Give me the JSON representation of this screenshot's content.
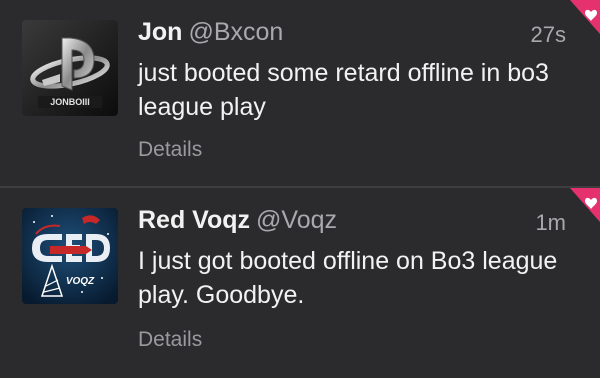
{
  "tweets": [
    {
      "name": "Jon",
      "handle": "@Bxcon",
      "time": "27s",
      "text": "just booted some retard offline in bo3 league play",
      "details_label": "Details",
      "avatar_caption": "JONBOIII",
      "favorite_color": "#e5316e"
    },
    {
      "name": "Red Voqz",
      "handle": "@Voqz",
      "time": "1m",
      "text": "I just got booted offline on Bo3 league play. Goodbye.",
      "details_label": "Details",
      "avatar_caption": "VOQZ",
      "favorite_color": "#e5316e"
    }
  ],
  "colors": {
    "background": "#2b2b2d",
    "separator": "#3d3d40",
    "primary_text": "#f2f2f2",
    "secondary_text": "#a9a9ad"
  }
}
